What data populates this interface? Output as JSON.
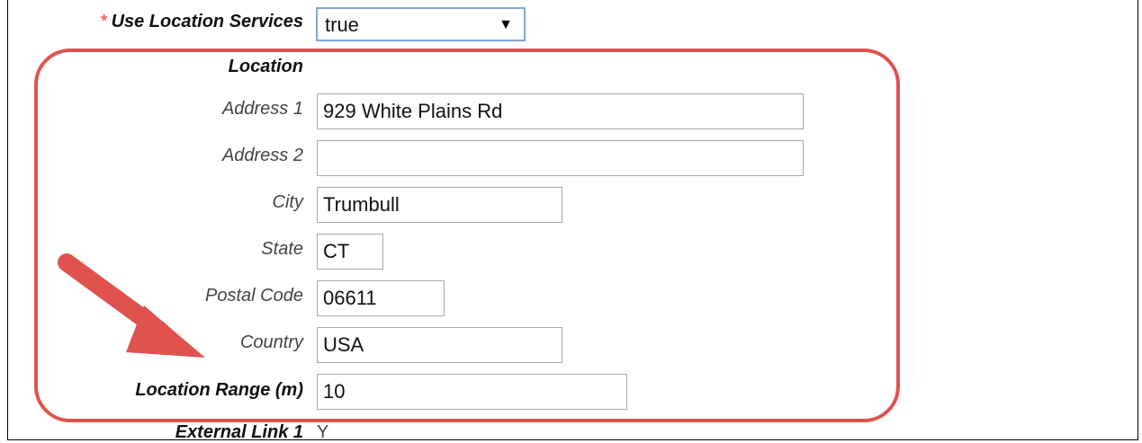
{
  "form": {
    "use_location_services": {
      "required_mark": "*",
      "label": "Use Location Services",
      "value": "true"
    },
    "location_header": "Location",
    "address1": {
      "label": "Address 1",
      "value": "929 White Plains Rd"
    },
    "address2": {
      "label": "Address 2",
      "value": ""
    },
    "city": {
      "label": "City",
      "value": "Trumbull"
    },
    "state": {
      "label": "State",
      "value": "CT"
    },
    "postal_code": {
      "label": "Postal Code",
      "value": "06611"
    },
    "country": {
      "label": "Country",
      "value": "USA"
    },
    "location_range": {
      "label": "Location Range (m)",
      "value": "10"
    },
    "next_field": {
      "label": "External Link 1",
      "value": "Y"
    }
  },
  "colors": {
    "highlight": "#e0524e",
    "arrow": "#e0524e",
    "required": "#e33333",
    "focus_border": "#7ea7d8"
  },
  "icons": {
    "select_caret": "caret-down-icon",
    "callout_arrow": "callout-arrow-icon"
  }
}
